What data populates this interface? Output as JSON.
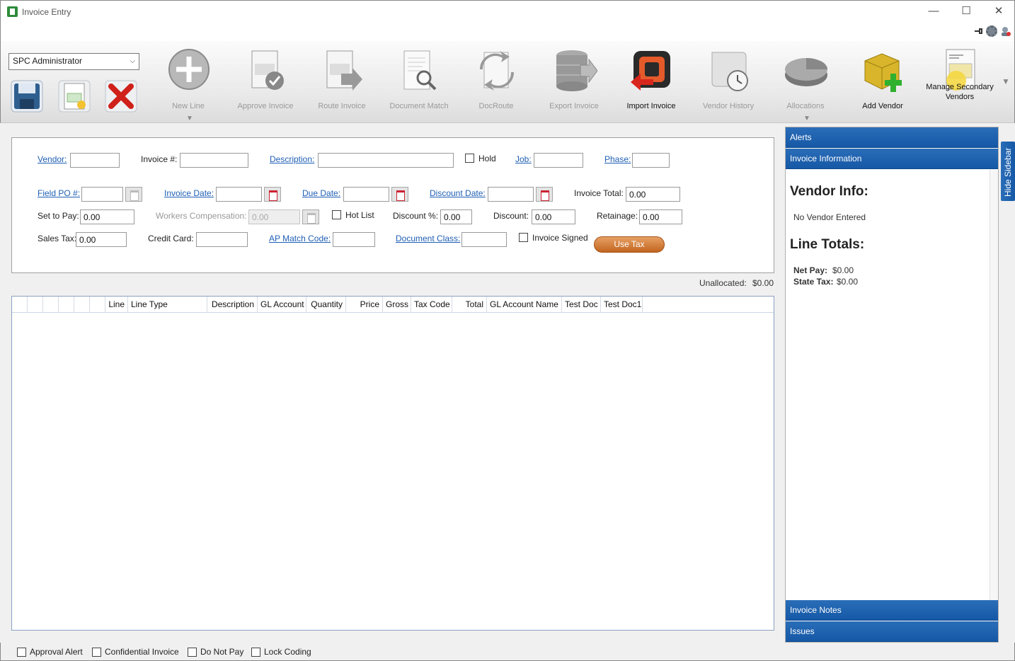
{
  "window": {
    "title": "Invoice Entry",
    "minimize": "—",
    "maximize": "☐",
    "close": "✕"
  },
  "toolbar": {
    "user_select": "SPC Administrator",
    "items": [
      {
        "label": "New Line",
        "icon": "plus-circle-icon"
      },
      {
        "label": "Approve Invoice",
        "icon": "invoice-check-icon"
      },
      {
        "label": "Route Invoice",
        "icon": "invoice-arrow-icon"
      },
      {
        "label": "Document Match",
        "icon": "document-search-icon"
      },
      {
        "label": "DocRoute",
        "icon": "docroute-icon"
      },
      {
        "label": "Export Invoice",
        "icon": "database-export-icon"
      },
      {
        "label": "Import Invoice",
        "icon": "import-icon"
      },
      {
        "label": "Vendor History",
        "icon": "scroll-clock-icon"
      },
      {
        "label": "Allocations",
        "icon": "pie-icon"
      },
      {
        "label": "Add Vendor",
        "icon": "cube-plus-icon"
      },
      {
        "label": "Manage Secondary Vendors",
        "icon": "quotation-icon"
      }
    ]
  },
  "form": {
    "vendor_label": "Vendor:",
    "invoice_no_label": "Invoice #:",
    "description_label": "Description:",
    "hold_label": "Hold",
    "job_label": "Job:",
    "phase_label": "Phase:",
    "field_po_label": "Field PO #:",
    "invoice_date_label": "Invoice Date:",
    "due_date_label": "Due Date:",
    "discount_date_label": "Discount Date:",
    "invoice_total_label": "Invoice Total:",
    "invoice_total_value": "0.00",
    "set_to_pay_label": "Set to Pay:",
    "set_to_pay_value": "0.00",
    "workers_comp_label": "Workers Compensation:",
    "workers_comp_value": "0.00",
    "hot_list_label": "Hot List",
    "discount_pct_label": "Discount %:",
    "discount_pct_value": "0.00",
    "discount_label": "Discount:",
    "discount_value": "0.00",
    "retainage_label": "Retainage:",
    "retainage_value": "0.00",
    "sales_tax_label": "Sales Tax:",
    "sales_tax_value": "0.00",
    "credit_card_label": "Credit Card:",
    "ap_match_label": "AP Match Code:",
    "doc_class_label": "Document Class:",
    "invoice_signed_label": "Invoice Signed",
    "use_tax_button": "Use Tax"
  },
  "unallocated": {
    "label": "Unallocated:",
    "value": "$0.00"
  },
  "grid": {
    "columns": [
      "Line",
      "Line Type",
      "Description",
      "GL Account",
      "Quantity",
      "Price",
      "Gross",
      "Tax Code",
      "Total",
      "GL Account Name",
      "Test Doc",
      "Test Doc1"
    ]
  },
  "sidebar": {
    "alerts": "Alerts",
    "invoice_information": "Invoice Information",
    "vendor_info_title": "Vendor Info:",
    "vendor_info_text": "No Vendor Entered",
    "line_totals_title": "Line Totals:",
    "net_pay_label": "Net Pay:",
    "net_pay_value": "$0.00",
    "state_tax_label": "State Tax:",
    "state_tax_value": "$0.00",
    "invoice_notes": "Invoice Notes",
    "issues": "Issues",
    "hide_sidebar": "Hide Sidebar"
  },
  "footer": {
    "approval_alert": "Approval Alert",
    "confidential_invoice": "Confidential Invoice",
    "do_not_pay": "Do Not Pay",
    "lock_coding": "Lock Coding"
  }
}
